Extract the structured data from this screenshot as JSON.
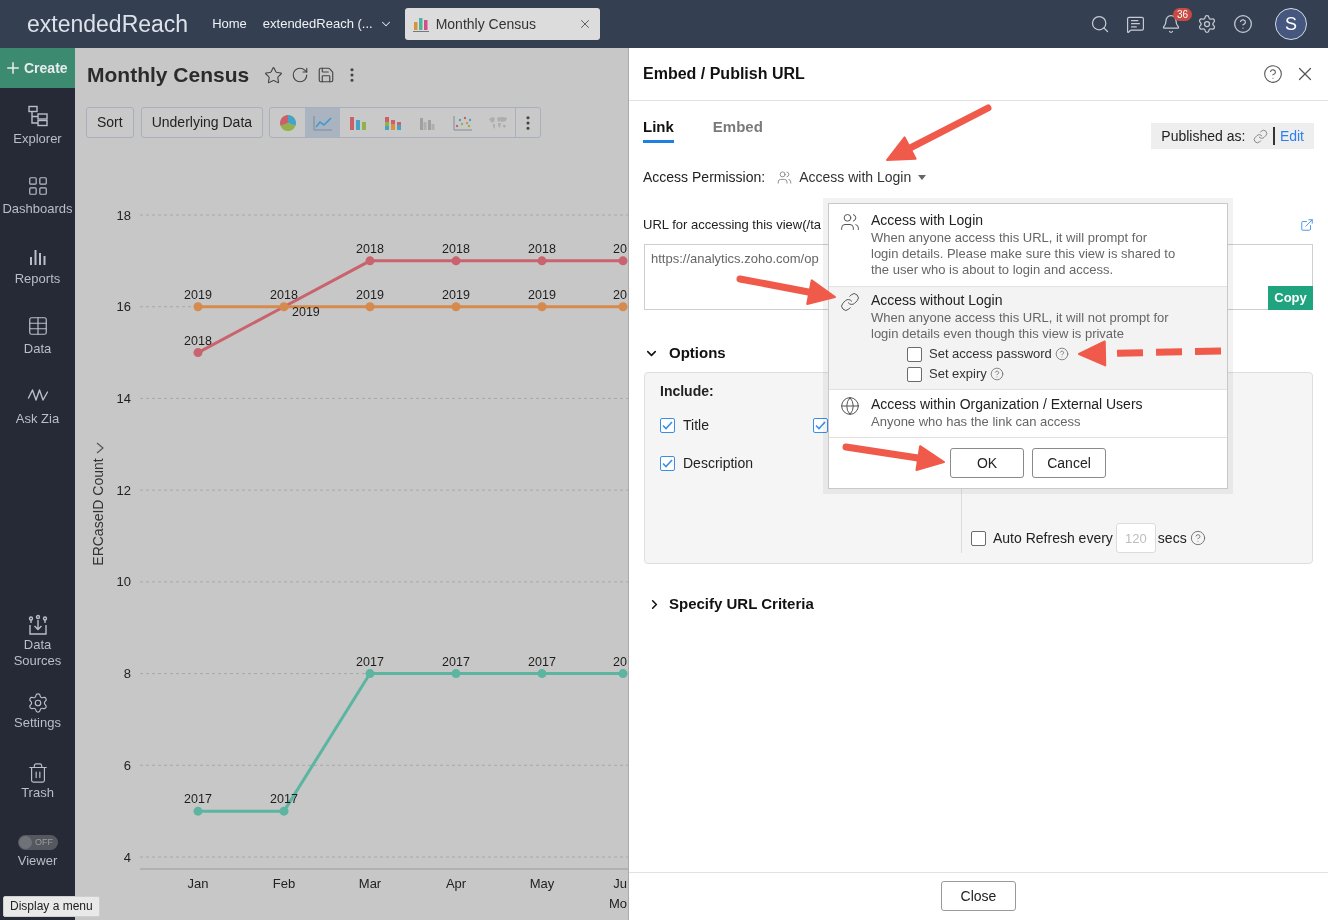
{
  "top_bar": {
    "app_name": "extendedReach",
    "nav": [
      {
        "label": "Home",
        "kind": "link"
      },
      {
        "label": "extendedReach (...",
        "kind": "menu"
      }
    ],
    "open_tab": {
      "label": "Monthly Census"
    },
    "notification_count": "36",
    "avatar_initial": "S"
  },
  "sidebar": {
    "create_label": "Create",
    "items": [
      {
        "label": "Explorer"
      },
      {
        "label": "Dashboards"
      },
      {
        "label": "Reports"
      },
      {
        "label": "Data"
      },
      {
        "label": "Ask Zia"
      }
    ],
    "bottom_items": [
      {
        "label": "Data Sources"
      },
      {
        "label": "Settings"
      },
      {
        "label": "Trash"
      }
    ],
    "viewer_toggle": {
      "label": "Viewer",
      "state_text": "OFF",
      "on": false
    }
  },
  "tooltip": "Display a menu",
  "report": {
    "title": "Monthly Census",
    "toolbar": {
      "buttons": [
        "Sort",
        "Underlying Data"
      ],
      "chart_types": [
        {
          "kind": "pie",
          "selected": false,
          "disabled": false
        },
        {
          "kind": "line",
          "selected": true,
          "disabled": false
        },
        {
          "kind": "bar",
          "selected": false,
          "disabled": false
        },
        {
          "kind": "stacked",
          "selected": false,
          "disabled": false
        },
        {
          "kind": "grouped",
          "selected": false,
          "disabled": true
        },
        {
          "kind": "scatter",
          "selected": false,
          "disabled": false
        },
        {
          "kind": "map",
          "selected": false,
          "disabled": true
        }
      ]
    },
    "chart_data": {
      "type": "line",
      "xlabel": "Mo",
      "ylabel": "ERCaseID Count",
      "categories": [
        "Jan",
        "Feb",
        "Mar",
        "Apr",
        "May",
        "Ju"
      ],
      "series": [
        {
          "name": "2018",
          "color": "#c9636d",
          "marker": "circle",
          "values": [
            15,
            16,
            17,
            17,
            17,
            17
          ]
        },
        {
          "name": "2019",
          "color": "#d68a4c",
          "marker": "circle",
          "values": [
            16,
            16,
            16,
            16,
            16,
            16
          ]
        },
        {
          "name": "2017",
          "color": "#5bb5a0",
          "marker": "circle",
          "values": [
            5,
            5,
            8,
            8,
            8,
            8
          ]
        }
      ],
      "ylim": [
        4,
        18
      ],
      "yticks": [
        4,
        6,
        8,
        10,
        12,
        14,
        16,
        18
      ],
      "grid": true,
      "annotations": [
        {
          "x": "Ju",
          "y": 17,
          "text": "20"
        },
        {
          "x": "Ju",
          "y": 16,
          "text": "20"
        },
        {
          "x": "Ju",
          "y": 8,
          "text": "20"
        }
      ]
    }
  },
  "publish_panel": {
    "title": "Embed / Publish URL",
    "tabs": [
      {
        "label": "Link",
        "selected": true
      },
      {
        "label": "Embed",
        "selected": false
      }
    ],
    "published_as": {
      "label": "Published as:",
      "action": "Edit"
    },
    "access_permission": {
      "label": "Access Permission:",
      "value": "Access with Login"
    },
    "url": {
      "label": "URL for accessing this view(/ta",
      "value": "https://analytics.zoho.com/op",
      "copy_button": "Copy"
    },
    "options": {
      "title": "Options",
      "expanded": true,
      "include_label": "Include:",
      "include": [
        {
          "label": "Title",
          "checked": true
        },
        {
          "checked": true
        },
        {
          "label": "Description",
          "checked": true
        }
      ],
      "auto_refresh": {
        "label": "Auto Refresh every",
        "checked": false,
        "placeholder": "120",
        "unit": "secs"
      }
    },
    "url_criteria": {
      "title": "Specify URL Criteria",
      "expanded": false
    },
    "close_button": "Close",
    "popover": {
      "options": [
        {
          "title": "Access with Login",
          "description": "When anyone access this URL, it will prompt for login details. Please make sure this view is shared to the user who is about to login and access.",
          "selected": false
        },
        {
          "title": "Access without Login",
          "description": "When anyone access this URL, it will not prompt for login details even though this view is private",
          "selected": true,
          "settings": [
            {
              "label": "Set access password",
              "checked": false
            },
            {
              "label": "Set expiry",
              "checked": false
            }
          ]
        },
        {
          "title": "Access within Organization / External Users",
          "description": "Anyone who has the link can access",
          "selected": false
        }
      ],
      "buttons": [
        "OK",
        "Cancel"
      ]
    }
  }
}
